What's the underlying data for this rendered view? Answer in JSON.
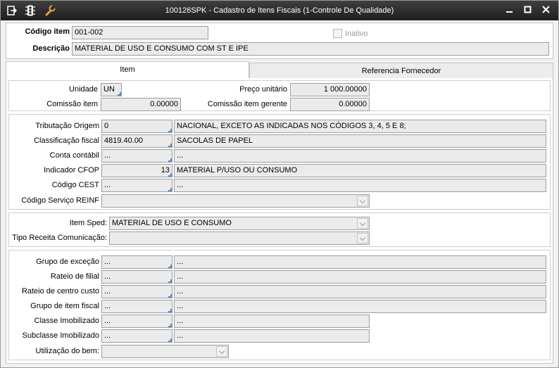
{
  "window": {
    "title": "100126SPK - Cadastro de Itens Fiscais (1-Controle De Qualidade)"
  },
  "toolbar": {
    "icons": [
      "export-icon",
      "traffic-light-icon",
      "wrench-icon"
    ]
  },
  "header": {
    "codigo_label": "Código item",
    "codigo_value": "001-002",
    "descricao_label": "Descrição",
    "descricao_value": "MATERIAL DE USO E CONSUMO COM ST E IPE",
    "inativo_label": "Inativo",
    "inativo_checked": false
  },
  "tabs": [
    {
      "label": "Item",
      "active": true
    },
    {
      "label": "Referencia Fornecedor",
      "active": false
    }
  ],
  "section1": {
    "unidade_label": "Unidade",
    "unidade_value": "UN",
    "preco_label": "Preço unitário",
    "preco_value": "1 000.00000",
    "comissao_label": "Comissão item",
    "comissao_value": "0.00000",
    "comissao_gerente_label": "Comissão item gerente",
    "comissao_gerente_value": "0.00000"
  },
  "section2": {
    "tributacao_label": "Tributação Origem",
    "tributacao_code": "0",
    "tributacao_desc": "NACIONAL, EXCETO AS INDICADAS NOS CÓDIGOS 3, 4, 5 E 8;",
    "classificacao_label": "Classificação fiscal",
    "classificacao_code": "4819.40.00",
    "classificacao_desc": "SACOLAS DE PAPEL",
    "conta_label": "Conta contábil",
    "conta_code": "...",
    "conta_desc": "...",
    "cfop_label": "Indicador CFOP",
    "cfop_code": "13",
    "cfop_desc": "MATERIAL P/USO OU CONSUMO",
    "cest_label": "Código CEST",
    "cest_code": "...",
    "cest_desc": "...",
    "reinf_label": "Código Serviço REINF",
    "reinf_value": ""
  },
  "section3": {
    "sped_label": "Item Sped:",
    "sped_value": "MATERIAL DE USO E CONSUMO",
    "receita_label": "Tipo Receita Comunicação:",
    "receita_value": ""
  },
  "section4": {
    "grupo_excecao_label": "Grupo de exceção",
    "grupo_excecao_code": "...",
    "grupo_excecao_desc": "...",
    "rateio_filial_label": "Rateio de filial",
    "rateio_filial_code": "...",
    "rateio_filial_desc": "...",
    "rateio_cc_label": "Rateio de centro custo",
    "rateio_cc_code": "...",
    "rateio_cc_desc": "...",
    "grupo_item_label": "Grupo de item fiscal",
    "grupo_item_code": "...",
    "grupo_item_desc": "...",
    "classe_label": "Classe Imobilizado",
    "classe_code": "...",
    "classe_desc": "...",
    "subclasse_label": "Subclasse Imobilizado",
    "subclasse_code": "...",
    "subclasse_desc": "...",
    "utilizacao_label": "Utilização do bem:",
    "utilizacao_value": ""
  },
  "colors": {
    "titlebar": "#2a2a2a",
    "field_bg": "#ebebeb",
    "lookup_corner": "#5a8ec8"
  }
}
